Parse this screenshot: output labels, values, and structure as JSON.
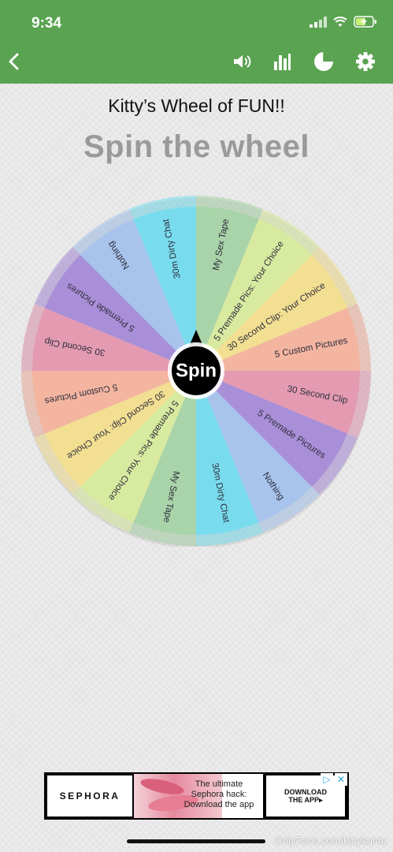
{
  "status_bar": {
    "time": "9:34"
  },
  "toolbar": {
    "back_icon": "chevron-left-icon",
    "icons": [
      "speaker-icon",
      "bar-chart-icon",
      "pie-chart-icon",
      "gear-icon"
    ]
  },
  "page": {
    "title": "Kitty’s Wheel of FUN!!",
    "subtitle": "Spin the wheel"
  },
  "wheel": {
    "center_label": "Spin",
    "segments": [
      {
        "label": "My Sex Tape",
        "color": "#a9d3a8"
      },
      {
        "label": "5 Premade Pics: Your Choice",
        "color": "#d8ea9f"
      },
      {
        "label": "30 Second Clip: Your Choice",
        "color": "#f3df92"
      },
      {
        "label": "5 Custom Pictures",
        "color": "#f3b5a0"
      },
      {
        "label": "30 Second Clip",
        "color": "#e49bb2"
      },
      {
        "label": "5 Premade Pictures",
        "color": "#a98fd8"
      },
      {
        "label": "Nothing",
        "color": "#a8c4ec"
      },
      {
        "label": "30m Dirty Chat",
        "color": "#79dcee"
      },
      {
        "label": "My Sex Tape",
        "color": "#a9d3a8"
      },
      {
        "label": "5 Premade Pics: Your Choice",
        "color": "#d8ea9f"
      },
      {
        "label": "30 Second Clip: Your Choice",
        "color": "#f3df92"
      },
      {
        "label": "5 Custom Pictures",
        "color": "#f3b5a0"
      },
      {
        "label": "30 Second Clip",
        "color": "#e49bb2"
      },
      {
        "label": "5 Premade Pictures",
        "color": "#a98fd8"
      },
      {
        "label": "Nothing",
        "color": "#a8c4ec"
      },
      {
        "label": "30m Dirty Chat",
        "color": "#79dcee"
      }
    ]
  },
  "ad": {
    "brand": "SEPHORA",
    "text": "The ultimate\nSephora hack:\nDownload the app",
    "cta": "DOWNLOAD\nTHE APP▸"
  },
  "watermark": "OnlyFans.com/kittykat4u",
  "colors": {
    "header": "#5aa351",
    "subtitle": "#9a9a9a"
  }
}
